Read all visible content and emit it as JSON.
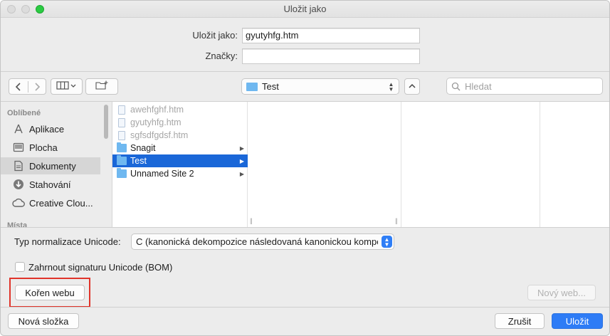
{
  "window": {
    "title": "Uložit jako"
  },
  "form": {
    "save_as_label": "Uložit jako:",
    "save_as_value": "gyutyhfg.htm",
    "tags_label": "Značky:",
    "tags_value": ""
  },
  "toolbar": {
    "back_icon": "chevron-left-icon",
    "forward_icon": "chevron-right-icon",
    "view_icon": "columns-view-icon",
    "new_folder_icon": "folder-plus-icon",
    "location": "Test",
    "search_placeholder": "Hledat"
  },
  "sidebar": {
    "sections": [
      {
        "label": "Oblíbené"
      },
      {
        "label": "Místa"
      }
    ],
    "items": [
      {
        "label": "Aplikace",
        "icon": "applications-icon"
      },
      {
        "label": "Plocha",
        "icon": "desktop-icon"
      },
      {
        "label": "Dokumenty",
        "icon": "documents-icon",
        "selected": true
      },
      {
        "label": "Stahování",
        "icon": "download-icon"
      },
      {
        "label": "Creative Clou...",
        "icon": "creative-cloud-icon"
      }
    ]
  },
  "browser": {
    "column1": [
      {
        "name": "awehfghf.htm",
        "kind": "file",
        "dim": true
      },
      {
        "name": "gyutyhfg.htm",
        "kind": "file",
        "dim": true
      },
      {
        "name": "sgfsdfgdsf.htm",
        "kind": "file",
        "dim": true
      },
      {
        "name": "Snagit",
        "kind": "folder"
      },
      {
        "name": "Test",
        "kind": "folder",
        "selected": true
      },
      {
        "name": "Unnamed Site 2",
        "kind": "folder"
      }
    ]
  },
  "options": {
    "unicode_norm_label": "Typ normalizace Unicode:",
    "unicode_norm_value": "C (kanonická dekompozice následovaná kanonickou kompoz...",
    "bom_label": "Zahrnout signaturu Unicode (BOM)",
    "bom_checked": false,
    "site_root_button": "Kořen webu",
    "new_web_button": "Nový web..."
  },
  "footer": {
    "new_folder_button": "Nová složka",
    "cancel_button": "Zrušit",
    "save_button": "Uložit"
  },
  "colors": {
    "accent": "#2e7cf6",
    "selection": "#1a67d8",
    "highlight_box": "#e0342a"
  }
}
